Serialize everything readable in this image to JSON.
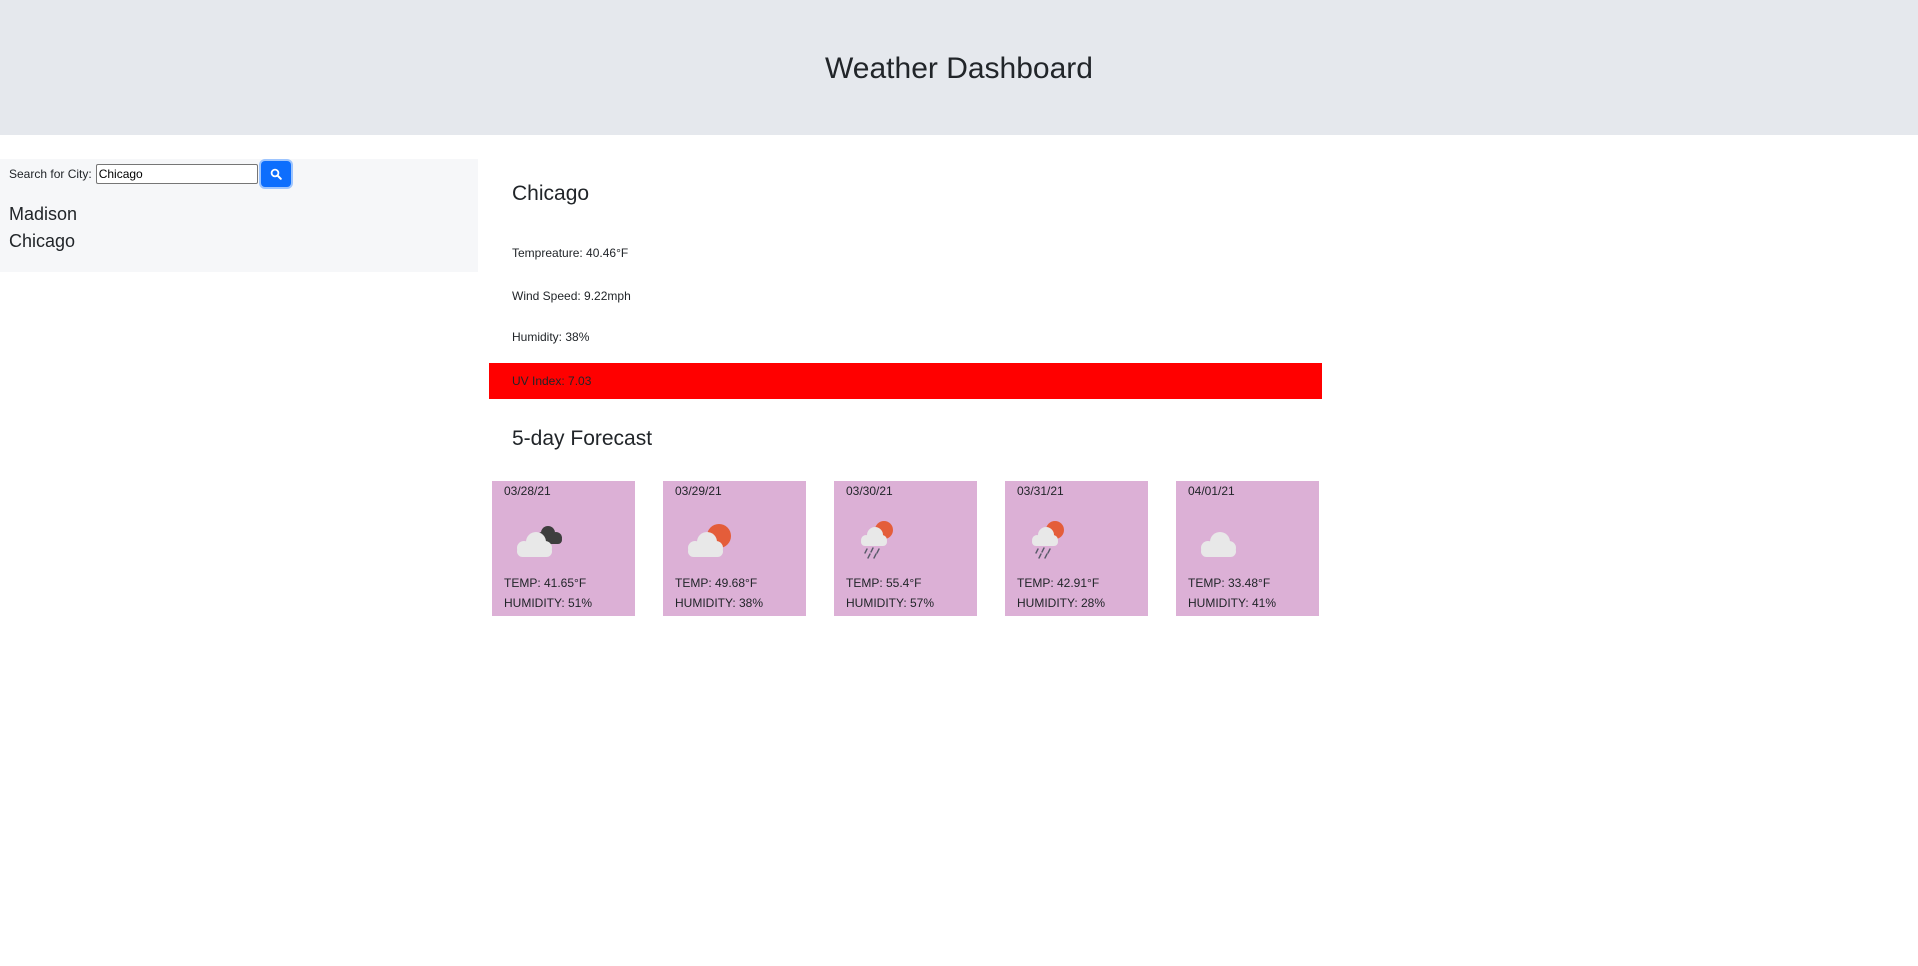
{
  "header": {
    "title": "Weather Dashboard"
  },
  "search": {
    "label": "Search for City:",
    "value": "Chicago",
    "button_icon": "search-icon"
  },
  "history": [
    "Madison",
    "Chicago"
  ],
  "current": {
    "city": "Chicago",
    "temperature": "Tempreature: 40.46°F",
    "wind": "Wind Speed: 9.22mph",
    "humidity": "Humidity: 38%",
    "uv": "UV Index: 7.03",
    "uv_color": "#ff0000"
  },
  "forecast": {
    "title": "5-day Forecast",
    "card_color": "#dcb0d6",
    "days": [
      {
        "date": "03/28/21",
        "icon": "broken-clouds-icon",
        "temp": "TEMP: 41.65°F",
        "humidity": "HUMIDITY: 51%"
      },
      {
        "date": "03/29/21",
        "icon": "few-clouds-icon",
        "temp": "TEMP: 49.68°F",
        "humidity": "HUMIDITY: 38%"
      },
      {
        "date": "03/30/21",
        "icon": "rain-icon",
        "temp": "TEMP: 55.4°F",
        "humidity": "HUMIDITY: 57%"
      },
      {
        "date": "03/31/21",
        "icon": "rain-icon",
        "temp": "TEMP: 42.91°F",
        "humidity": "HUMIDITY: 28%"
      },
      {
        "date": "04/01/21",
        "icon": "cloud-icon",
        "temp": "TEMP: 33.48°F",
        "humidity": "HUMIDITY: 41%"
      }
    ]
  }
}
